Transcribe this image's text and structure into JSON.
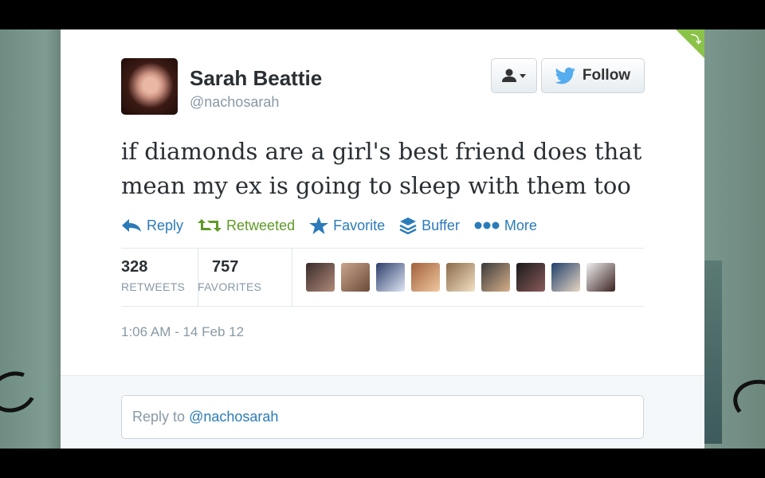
{
  "tweet": {
    "user": {
      "name": "Sarah Beattie",
      "handle": "@nachosarah"
    },
    "text": "if diamonds are a girl's best friend does that mean my ex is going to sleep with them too",
    "buttons": {
      "follow_label": "Follow"
    },
    "actions": [
      {
        "label": "Reply",
        "icon": "reply-icon"
      },
      {
        "label": "Retweeted",
        "icon": "retweet-icon"
      },
      {
        "label": "Favorite",
        "icon": "star-icon"
      },
      {
        "label": "Buffer",
        "icon": "buffer-icon"
      },
      {
        "label": "More",
        "icon": "more-dots-icon"
      }
    ],
    "stats": {
      "retweets": {
        "count": "328",
        "label": "RETWEETS"
      },
      "favorites": {
        "count": "757",
        "label": "FAVORITES"
      }
    },
    "timestamp": "1:06 AM - 14 Feb 12",
    "reply": {
      "prefix": "Reply to",
      "mention": "@nachosarah"
    }
  },
  "colors": {
    "link": "#2b7bb9",
    "retweeted": "#609928",
    "corner": "#8bc34a",
    "muted": "#8899a6"
  },
  "favoriter_avatars": [
    {
      "name": "favoriter-avatar-1",
      "bg": "linear-gradient(135deg,#3a2b2b,#b08b7a)"
    },
    {
      "name": "favoriter-avatar-2",
      "bg": "linear-gradient(135deg,#c8a58b,#6b4a3a)"
    },
    {
      "name": "favoriter-avatar-3",
      "bg": "linear-gradient(135deg,#2d3e6b,#dfe6f5)"
    },
    {
      "name": "favoriter-avatar-4",
      "bg": "linear-gradient(135deg,#a0603a,#f0c8a0)"
    },
    {
      "name": "favoriter-avatar-5",
      "bg": "linear-gradient(135deg,#8a6a4a,#f3e1c4)"
    },
    {
      "name": "favoriter-avatar-6",
      "bg": "linear-gradient(135deg,#3a3a3a,#d7b08a)"
    },
    {
      "name": "favoriter-avatar-7",
      "bg": "linear-gradient(135deg,#1a1a1a,#8a5a5a)"
    },
    {
      "name": "favoriter-avatar-8",
      "bg": "linear-gradient(135deg,#1f3f6b,#e8d6c2)"
    },
    {
      "name": "favoriter-avatar-9",
      "bg": "linear-gradient(135deg,#f0f0f0,#3b2220)"
    }
  ]
}
